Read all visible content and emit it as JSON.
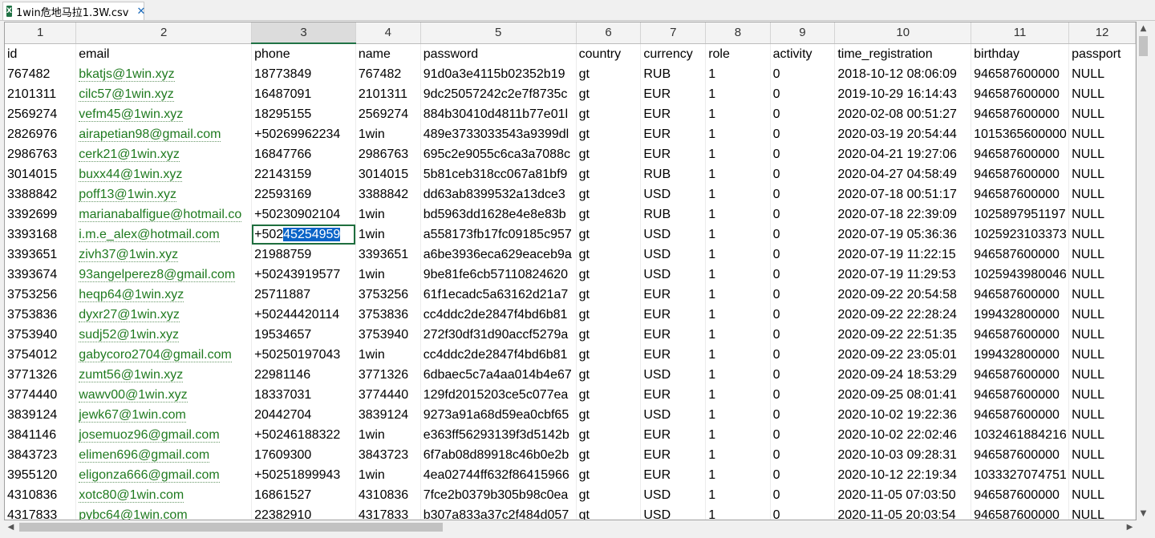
{
  "tab": {
    "title": "1win危地马拉1.3W.csv",
    "close_glyph": "✕",
    "icon_letter": "X"
  },
  "column_numbers": [
    "1",
    "2",
    "3",
    "4",
    "5",
    "6",
    "7",
    "8",
    "9",
    "10",
    "11",
    "12"
  ],
  "headers": [
    "id",
    "email",
    "phone",
    "name",
    "password",
    "country",
    "currency",
    "role",
    "activity",
    "time_registration",
    "birthday",
    "passport"
  ],
  "rows": [
    [
      "767482",
      "bkatjs@1win.xyz",
      "18773849",
      "767482",
      "91d0a3e4115b02352b19",
      "gt",
      "RUB",
      "1",
      "0",
      "2018-10-12 08:06:09",
      "946587600000",
      "NULL"
    ],
    [
      "2101311",
      "cilc57@1win.xyz",
      "16487091",
      "2101311",
      "9dc25057242c2e7f8735c",
      "gt",
      "EUR",
      "1",
      "0",
      "2019-10-29 16:14:43",
      "946587600000",
      "NULL"
    ],
    [
      "2569274",
      "vefm45@1win.xyz",
      "18295155",
      "2569274",
      "884b30410d4811b77e01l",
      "gt",
      "EUR",
      "1",
      "0",
      "2020-02-08 00:51:27",
      "946587600000",
      "NULL"
    ],
    [
      "2826976",
      "airapetian98@gmail.com",
      "+50269962234",
      "1win",
      "489e3733033543a9399dl",
      "gt",
      "EUR",
      "1",
      "0",
      "2020-03-19 20:54:44",
      "1015365600000",
      "NULL"
    ],
    [
      "2986763",
      "cerk21@1win.xyz",
      "16847766",
      "2986763",
      "695c2e9055c6ca3a7088c",
      "gt",
      "EUR",
      "1",
      "0",
      "2020-04-21 19:27:06",
      "946587600000",
      "NULL"
    ],
    [
      "3014015",
      "buxx44@1win.xyz",
      "22143159",
      "3014015",
      "5b81ceb318cc067a81bf9",
      "gt",
      "RUB",
      "1",
      "0",
      "2020-04-27 04:58:49",
      "946587600000",
      "NULL"
    ],
    [
      "3388842",
      "poff13@1win.xyz",
      "22593169",
      "3388842",
      "dd63ab8399532a13dce3",
      "gt",
      "USD",
      "1",
      "0",
      "2020-07-18 00:51:17",
      "946587600000",
      "NULL"
    ],
    [
      "3392699",
      "marianabalfigue@hotmail.co",
      "+50230902104",
      "1win",
      "bd5963dd1628e4e8e83b",
      "gt",
      "RUB",
      "1",
      "0",
      "2020-07-18 22:39:09",
      "1025897951197",
      "NULL"
    ],
    [
      "3393168",
      "i.m.e_alex@hotmail.com",
      "+50245254959",
      "1win",
      "a558173fb17fc09185c957",
      "gt",
      "USD",
      "1",
      "0",
      "2020-07-19 05:36:36",
      "1025923103373",
      "NULL"
    ],
    [
      "3393651",
      "zivh37@1win.xyz",
      "21988759",
      "3393651",
      "a6be3936eca629eaceb9a",
      "gt",
      "USD",
      "1",
      "0",
      "2020-07-19 11:22:15",
      "946587600000",
      "NULL"
    ],
    [
      "3393674",
      "93angelperez8@gmail.com",
      "+50243919577",
      "1win",
      "9be81fe6cb57110824620",
      "gt",
      "USD",
      "1",
      "0",
      "2020-07-19 11:29:53",
      "1025943980046",
      "NULL"
    ],
    [
      "3753256",
      "heqp64@1win.xyz",
      "25711887",
      "3753256",
      "61f1ecadc5a63162d21a7",
      "gt",
      "EUR",
      "1",
      "0",
      "2020-09-22 20:54:58",
      "946587600000",
      "NULL"
    ],
    [
      "3753836",
      "dyxr27@1win.xyz",
      "+50244420114",
      "3753836",
      "cc4ddc2de2847f4bd6b81",
      "gt",
      "EUR",
      "1",
      "0",
      "2020-09-22 22:28:24",
      "199432800000",
      "NULL"
    ],
    [
      "3753940",
      "sudj52@1win.xyz",
      "19534657",
      "3753940",
      "272f30df31d90accf5279a",
      "gt",
      "EUR",
      "1",
      "0",
      "2020-09-22 22:51:35",
      "946587600000",
      "NULL"
    ],
    [
      "3754012",
      "gabycoro2704@gmail.com",
      "+50250197043",
      "1win",
      "cc4ddc2de2847f4bd6b81",
      "gt",
      "EUR",
      "1",
      "0",
      "2020-09-22 23:05:01",
      "199432800000",
      "NULL"
    ],
    [
      "3771326",
      "zumt56@1win.xyz",
      "22981146",
      "3771326",
      "6dbaec5c7a4aa014b4e67",
      "gt",
      "USD",
      "1",
      "0",
      "2020-09-24 18:53:29",
      "946587600000",
      "NULL"
    ],
    [
      "3774440",
      "wawv00@1win.xyz",
      "18337031",
      "3774440",
      "129fd2015203ce5c077ea",
      "gt",
      "EUR",
      "1",
      "0",
      "2020-09-25 08:01:41",
      "946587600000",
      "NULL"
    ],
    [
      "3839124",
      "jewk67@1win.com",
      "20442704",
      "3839124",
      "9273a91a68d59ea0cbf65",
      "gt",
      "USD",
      "1",
      "0",
      "2020-10-02 19:22:36",
      "946587600000",
      "NULL"
    ],
    [
      "3841146",
      "josemuoz96@gmail.com",
      "+50246188322",
      "1win",
      "e363ff56293139f3d5142b",
      "gt",
      "EUR",
      "1",
      "0",
      "2020-10-02 22:02:46",
      "1032461884216",
      "NULL"
    ],
    [
      "3843723",
      "elimen696@gmail.com",
      "17609300",
      "3843723",
      "6f7ab08d89918c46b0e2b",
      "gt",
      "EUR",
      "1",
      "0",
      "2020-10-03 09:28:31",
      "946587600000",
      "NULL"
    ],
    [
      "3955120",
      "eligonza666@gmail.com",
      "+50251899943",
      "1win",
      "4ea02744ff632f86415966",
      "gt",
      "EUR",
      "1",
      "0",
      "2020-10-12 22:19:34",
      "1033327074751",
      "NULL"
    ],
    [
      "4310836",
      "xotc80@1win.com",
      "16861527",
      "4310836",
      "7fce2b0379b305b98c0ea",
      "gt",
      "USD",
      "1",
      "0",
      "2020-11-05 07:03:50",
      "946587600000",
      "NULL"
    ],
    [
      "4317833",
      "pybc64@1win.com",
      "22382910",
      "4317833",
      "b307a833a37c2f484d057",
      "gt",
      "USD",
      "1",
      "0",
      "2020-11-05 20:03:54",
      "946587600000",
      "NULL"
    ]
  ],
  "active_cell": {
    "row": 8,
    "col": 2,
    "plain_part": "+502",
    "selected_part": "45254959"
  },
  "scroll_arrows": {
    "up": "▲",
    "down": "▼",
    "left": "◀",
    "right": "▶"
  }
}
